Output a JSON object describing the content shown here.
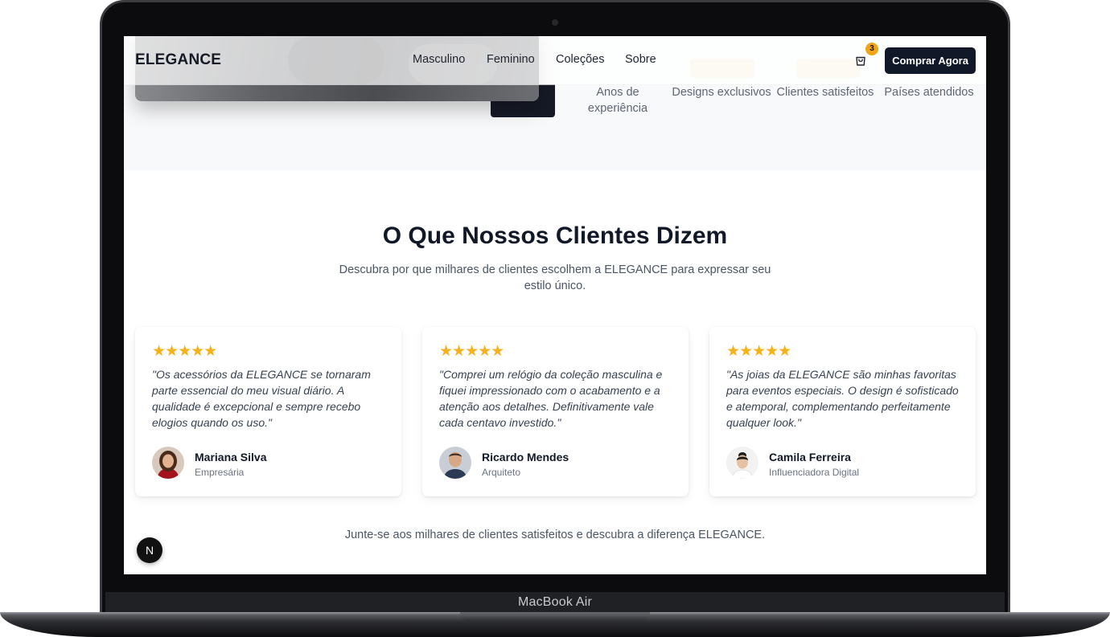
{
  "device": {
    "label": "MacBook Air"
  },
  "header": {
    "logo": "ELEGANCE",
    "nav": [
      "Masculino",
      "Feminino",
      "Coleções",
      "Sobre"
    ],
    "cart_count": "3",
    "cta_label": "Comprar Agora"
  },
  "stats": [
    {
      "label": "Anos de experiência"
    },
    {
      "label": "Designs exclusivos"
    },
    {
      "label": "Clientes satisfeitos"
    },
    {
      "label": "Países atendidos"
    }
  ],
  "testimonials": {
    "title": "O Que Nossos Clientes Dizem",
    "subtitle": "Descubra por que milhares de clientes escolhem a ELEGANCE para expressar seu estilo único.",
    "items": [
      {
        "rating": 5,
        "stars": "★★★★★",
        "quote": "\"Os acessórios da ELEGANCE se tornaram parte essencial do meu visual diário. A qualidade é excepcional e sempre recebo elogios quando os uso.\"",
        "name": "Mariana Silva",
        "role": "Empresária"
      },
      {
        "rating": 5,
        "stars": "★★★★★",
        "quote": "\"Comprei um relógio da coleção masculina e fiquei impressionado com o acabamento e a atenção aos detalhes. Definitivamente vale cada centavo investido.\"",
        "name": "Ricardo Mendes",
        "role": "Arquiteto"
      },
      {
        "rating": 5,
        "stars": "★★★★★",
        "quote": "\"As joias da ELEGANCE são minhas favoritas para eventos especiais. O design é sofisticado e atemporal, complementando perfeitamente qualquer look.\"",
        "name": "Camila Ferreira",
        "role": "Influenciadora Digital"
      }
    ],
    "closing": "Junte-se aos milhares de clientes satisfeitos e descubra a diferença ELEGANCE."
  },
  "dev_badge": {
    "letter": "N"
  },
  "colors": {
    "primary": "#111827",
    "star": "#f5b21c",
    "badge": "#f2a516",
    "muted": "#4b5563"
  }
}
